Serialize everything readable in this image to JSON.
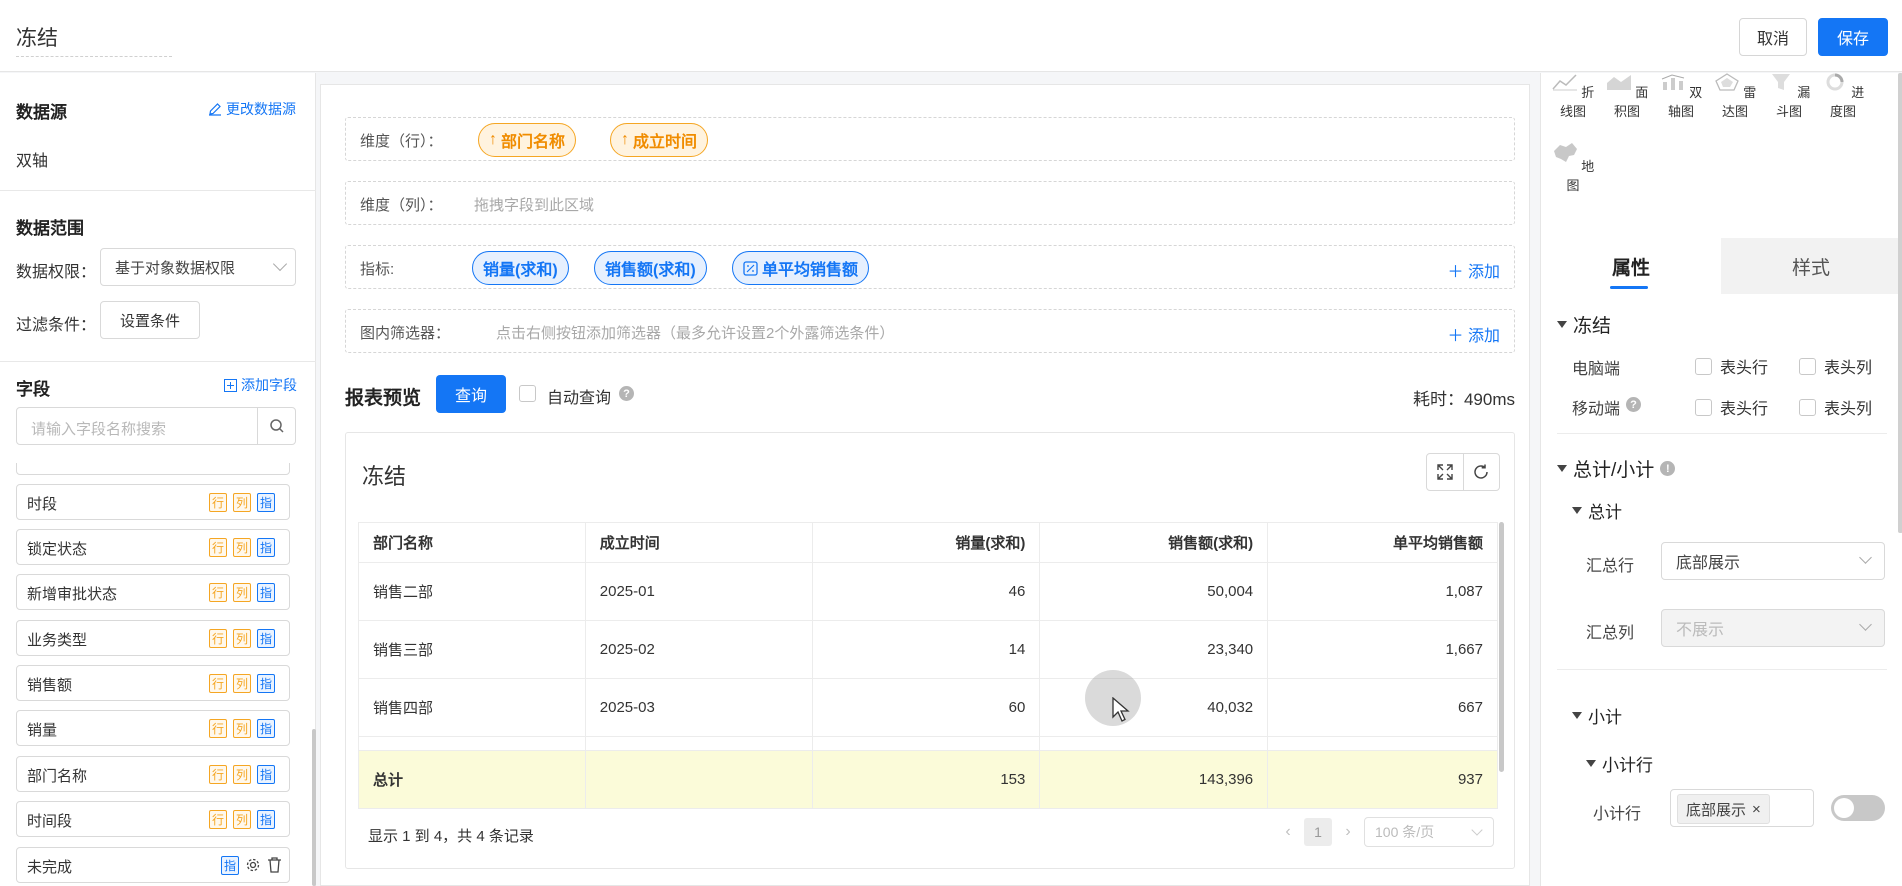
{
  "topbar": {
    "title": "冻结",
    "cancel": "取消",
    "save": "保存"
  },
  "left": {
    "datasource_title": "数据源",
    "change_datasource": "更改数据源",
    "datasource_value": "双轴",
    "range_title": "数据范围",
    "permission_label": "数据权限：",
    "permission_value": "基于对象数据权限",
    "filter_label": "过滤条件：",
    "filter_button": "设置条件",
    "fields_title": "字段",
    "add_field": "添加字段",
    "search_placeholder": "请输入字段名称搜索",
    "tag_row": "行",
    "tag_col": "列",
    "tag_ind": "指",
    "fields": [
      "时段",
      "锁定状态",
      "新增审批状态",
      "业务类型",
      "销售额",
      "销量",
      "部门名称",
      "时间段",
      "未完成"
    ]
  },
  "center": {
    "dim_row_label": "维度（行）：",
    "dim_row_chips": [
      "部门名称",
      "成立时间"
    ],
    "dim_col_label": "维度（列）：",
    "dim_col_placeholder": "拖拽字段到此区域",
    "metric_label": "指标:",
    "metric_chips": [
      "销量(求和)",
      "销售额(求和)",
      "单平均销售额"
    ],
    "add_label": "添加",
    "filter_label": "图内筛选器：",
    "filter_placeholder": "点击右侧按钮添加筛选器（最多允许设置2个外露筛选条件）",
    "preview_title": "报表预览",
    "query_button": "查询",
    "auto_query": "自动查询",
    "elapsed": "耗时：490ms",
    "report_title": "冻结",
    "table": {
      "headers": [
        "部门名称",
        "成立时间",
        "销量(求和)",
        "销售额(求和)",
        "单平均销售额"
      ],
      "rows": [
        [
          "销售二部",
          "2025-01",
          "46",
          "50,004",
          "1,087"
        ],
        [
          "销售三部",
          "2025-02",
          "14",
          "23,340",
          "1,667"
        ],
        [
          "销售四部",
          "2025-03",
          "60",
          "40,032",
          "667"
        ]
      ],
      "total": [
        "总计",
        "",
        "153",
        "143,396",
        "937"
      ]
    },
    "pager_info": "显示 1 到 4，共 4 条记录",
    "page_current": "1",
    "page_size": "100 条/页"
  },
  "right": {
    "chart_types": [
      "折线图",
      "面积图",
      "双轴图",
      "雷达图",
      "漏斗图",
      "进度图",
      "地图"
    ],
    "tab_props": "属性",
    "tab_style": "样式",
    "freeze_title": "冻结",
    "pc_label": "电脑端",
    "mobile_label": "移动端",
    "header_row": "表头行",
    "header_col": "表头列",
    "total_title": "总计/小计",
    "total_sub": "总计",
    "total_row_label": "汇总行",
    "total_row_value": "底部展示",
    "total_col_label": "汇总列",
    "total_col_value": "不展示",
    "subtotal_sub": "小计",
    "subtotal_row_sub": "小计行",
    "subtotal_row_label": "小计行",
    "subtotal_row_value": "底部展示"
  }
}
